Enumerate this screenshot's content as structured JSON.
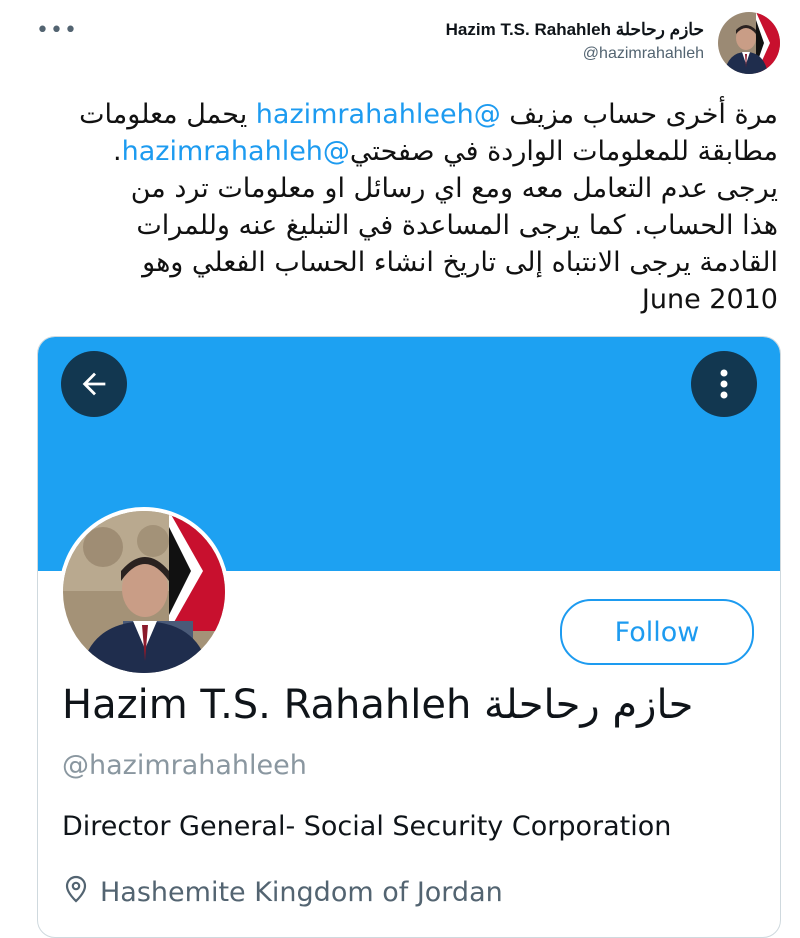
{
  "tweet": {
    "author_name": "Hazim T.S. Rahahleh حازم رحاحلة",
    "author_handle": "@hazimrahahleh",
    "more_icon": "more-horizontal-icon",
    "text": {
      "line1_before": "مرة أخرى حساب مزيف ",
      "mention_fake": "@hazimrahahleeh",
      "line1_after": " يحمل معلومات",
      "line2_before": "مطابقة للمعلومات الواردة في صفحتي",
      "mention_real": "@hazimrahahleh",
      "line2_after": ".",
      "line3": "يرجى عدم التعامل معه ومع اي رسائل او معلومات ترد  من",
      "line4": "هذا الحساب. كما يرجى المساعدة في التبليغ عنه وللمرات",
      "line5": "القادمة يرجى الانتباه إلى تاريخ انشاء الحساب الفعلي وهو",
      "line6": "June 2010"
    }
  },
  "profile_card": {
    "banner_color": "#1da1f2",
    "back_icon": "arrow-left-icon",
    "menu_icon": "more-vertical-icon",
    "follow_label": "Follow",
    "name": "Hazim T.S. Rahahleh حازم رحاحلة",
    "handle": "@hazimrahahleeh",
    "bio": "Director General- Social Security Corporation",
    "location_icon": "location-pin-icon",
    "location": "Hashemite Kingdom of Jordan"
  }
}
